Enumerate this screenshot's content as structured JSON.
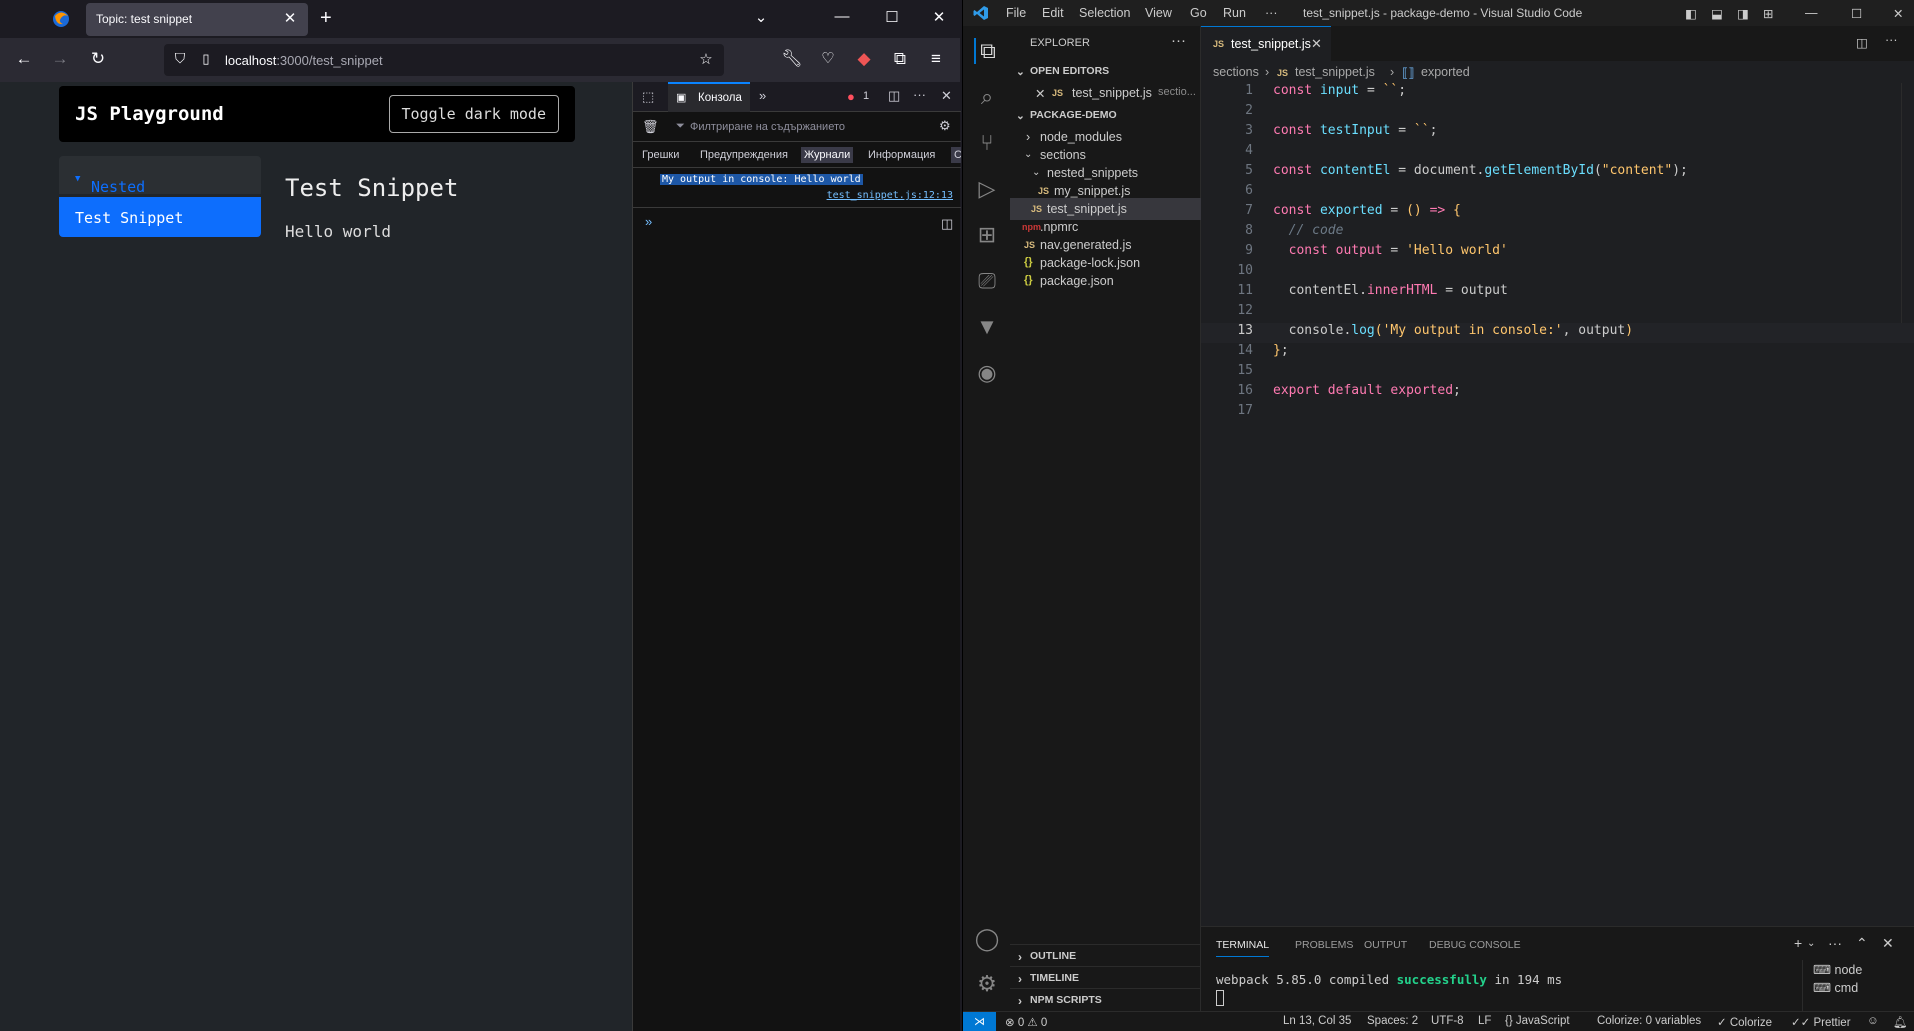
{
  "firefox": {
    "tab_title": "Topic: test snippet",
    "url_host": "localhost",
    "url_path": ":3000/test_snippet",
    "page": {
      "brand": "JS Playground",
      "toggle_label": "Toggle dark mode",
      "nested_label": "Nested Snippets",
      "active_label": "Test Snippet",
      "title": "Test Snippet",
      "content": "Hello world"
    },
    "devtools": {
      "console_tab": "Конзола",
      "error_count": "1",
      "filter_placeholder": "Филтриране на съдържанието",
      "levels": [
        "Грешки",
        "Предупреждения",
        "Журнали",
        "Информация",
        "С"
      ],
      "log_message": "My output in console: Hello world",
      "log_source": "test_snippet.js:12:13"
    }
  },
  "vscode": {
    "menu": [
      "File",
      "Edit",
      "Selection",
      "View",
      "Go",
      "Run",
      "···"
    ],
    "window_title": "test_snippet.js - package-demo - Visual Studio Code",
    "explorer_title": "EXPLORER",
    "open_editors_label": "OPEN EDITORS",
    "open_editor_file": "test_snippet.js",
    "open_editor_path": "sectio...",
    "project_label": "PACKAGE-DEMO",
    "tree": [
      "node_modules",
      "sections",
      "nested_snippets",
      "my_snippet.js",
      "test_snippet.js",
      ".npmrc",
      "nav.generated.js",
      "package-lock.json",
      "package.json"
    ],
    "bottom_sections": [
      "OUTLINE",
      "TIMELINE",
      "NPM SCRIPTS"
    ],
    "editor_tab": "test_snippet.js",
    "breadcrumbs": [
      "sections",
      "test_snippet.js",
      "exported"
    ],
    "line_numbers": [
      "1",
      "2",
      "3",
      "4",
      "5",
      "6",
      "7",
      "8",
      "9",
      "10",
      "11",
      "12",
      "13",
      "14",
      "15",
      "16",
      "17"
    ],
    "panel_tabs": [
      "TERMINAL",
      "PROBLEMS",
      "OUTPUT",
      "DEBUG CONSOLE"
    ],
    "terminal_prefix": "webpack 5.85.0 compiled ",
    "terminal_ok": "successfully",
    "terminal_suffix": " in 194 ms",
    "terminals": [
      "node",
      "cmd"
    ],
    "status": {
      "problems": "⊗ 0 ⚠ 0",
      "position": "Ln 13, Col 35",
      "spaces": "Spaces: 2",
      "encoding": "UTF-8",
      "eol": "LF",
      "language": "{} JavaScript",
      "colorize_vars": "Colorize: 0 variables",
      "colorize": "✓ Colorize",
      "prettier": "✓✓ Prettier"
    }
  }
}
